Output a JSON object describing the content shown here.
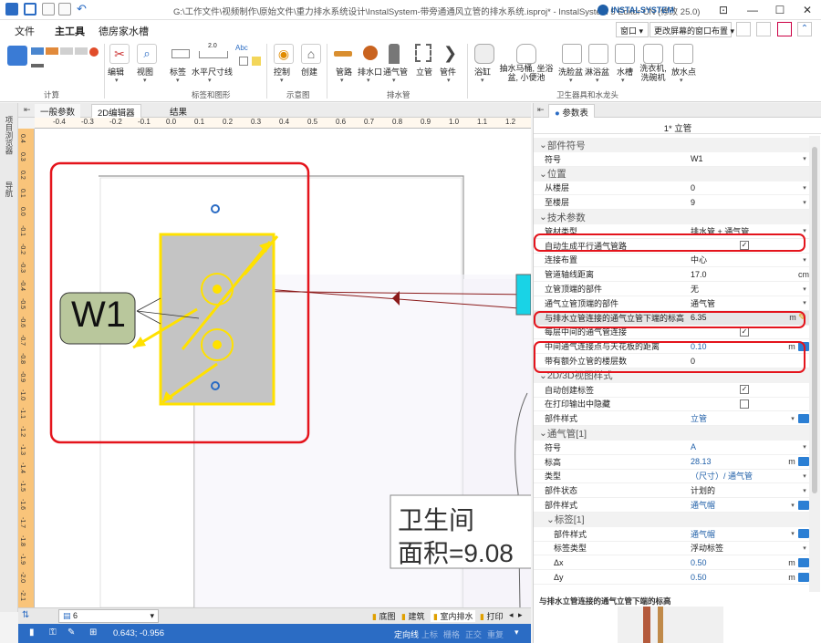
{
  "window": {
    "title": "G:\\工作文件\\视频制作\\原始文件\\重力排水系统设计\\InstalSystem-带旁通通风立管的排水系统.isproj* - InstalSystem 5 Editor CN (修改 25.0)",
    "logo_text": "INSTALSYSTEM"
  },
  "menu": {
    "items": [
      "文件",
      "主工具",
      "德房家水槽"
    ],
    "window_dropdown": "窗口",
    "layout_dropdown": "更改屏幕的窗口布置"
  },
  "ribbon": {
    "groups": [
      {
        "label": "计算"
      },
      {
        "label": "标签和图形",
        "buttons": [
          "编辑",
          "视图",
          "标签",
          "水平尺寸线"
        ]
      },
      {
        "label": "示意图",
        "buttons": [
          "控制",
          "创建"
        ]
      },
      {
        "label": "排水管",
        "buttons": [
          "管路",
          "排水口",
          "通气管",
          "立管",
          "管件"
        ]
      },
      {
        "label": "卫生器具和水龙头",
        "buttons": [
          "浴缸",
          "抽水马桶, 坐浴盆, 小便池",
          "洗脸盆",
          "淋浴盆",
          "水槽",
          "洗衣机, 洗碗机",
          "放水点"
        ]
      }
    ],
    "abc_label": "Abc",
    "dim_label": "2.0"
  },
  "side_tabs": [
    "项目浏览器",
    "导航"
  ],
  "doc_tabs": [
    "一般参数",
    "2D编辑器",
    "结果"
  ],
  "ruler": {
    "h_ticks": [
      "-0.4",
      "-0.3",
      "-0.2",
      "-0.1",
      "0.0",
      "0.1",
      "0.2",
      "0.3",
      "0.4",
      "0.5",
      "0.6",
      "0.7",
      "0.8",
      "0.9",
      "1.0",
      "1.1",
      "1.2",
      "1.3"
    ],
    "v_ticks": [
      "0.4",
      "0.3",
      "0.2",
      "0.1",
      "0.0",
      "-0.1",
      "-0.2",
      "-0.3",
      "-0.4",
      "-0.5",
      "-0.6",
      "-0.7",
      "-0.8",
      "-0.9",
      "-1.0",
      "-1.1",
      "-1.2",
      "-1.3",
      "-1.4",
      "-1.5",
      "-1.6",
      "-1.7",
      "-1.8",
      "-1.9",
      "-2.0",
      "-2.1"
    ]
  },
  "canvas": {
    "riser_label": "W1",
    "room_name": "卫生间",
    "room_area": "面积=9.08"
  },
  "bottom_tabs": [
    "底图",
    "建筑",
    "室内排水",
    "打印"
  ],
  "status": {
    "zoom_value": "6",
    "coords": "0.643; -0.956",
    "mode_items": [
      "定向线",
      "上标",
      "栅格",
      "正交",
      "重复"
    ]
  },
  "props": {
    "panel_title": "参数表",
    "object_title": "1* 立管",
    "rows": [
      {
        "type": "cat",
        "label": "部件符号"
      },
      {
        "type": "row",
        "label": "符号",
        "value": "W1",
        "dd": true
      },
      {
        "type": "cat",
        "label": "位置"
      },
      {
        "type": "row",
        "label": "从楼层",
        "value": "0",
        "dd": true
      },
      {
        "type": "row",
        "label": "至楼层",
        "value": "9",
        "dd": true
      },
      {
        "type": "cat",
        "label": "技术参数"
      },
      {
        "type": "row",
        "label": "管材类型",
        "value": "排水管 + 通气管",
        "dd": true
      },
      {
        "type": "row",
        "label": "自动生成平行通气管路",
        "check": true
      },
      {
        "type": "row",
        "label": "连接布置",
        "value": "中心",
        "dd": true
      },
      {
        "type": "row",
        "label": "管道轴线距离",
        "value": "17.0",
        "unit": "cm"
      },
      {
        "type": "row",
        "label": "立管顶端的部件",
        "value": "无",
        "dd": true
      },
      {
        "type": "row",
        "label": "通气立管顶端的部件",
        "value": "通气管",
        "dd": true
      },
      {
        "type": "row",
        "label": "与排水立管连接的通气立管下端的标高",
        "value": "6.35",
        "unit": "m",
        "icon": "pencil-icon",
        "shade": true
      },
      {
        "type": "row",
        "label": "每层中间的通气管连接",
        "check": true
      },
      {
        "type": "row",
        "label": "中间通气连接点与天花板的距离",
        "value": "0.10",
        "unit": "m",
        "icon": "link-icon",
        "blue": true
      },
      {
        "type": "row",
        "label": "带有额外立管的楼层数",
        "value": "0"
      },
      {
        "type": "cat",
        "label": "2D/3D视图样式"
      },
      {
        "type": "row",
        "label": "自动创建标签",
        "check": true
      },
      {
        "type": "row",
        "label": "在打印输出中隐藏",
        "check": false
      },
      {
        "type": "row",
        "label": "部件样式",
        "value": "立管",
        "dd": true,
        "icon": "link-icon",
        "blue": true
      },
      {
        "type": "cat",
        "label": "通气管[1]"
      },
      {
        "type": "row",
        "label": "符号",
        "value": "A",
        "dd": true,
        "blue": true
      },
      {
        "type": "row",
        "label": "标高",
        "value": "28.13",
        "unit": "m",
        "icon": "link-icon",
        "blue": true
      },
      {
        "type": "row",
        "label": "类型",
        "value": "（尺寸）/ 通气管",
        "dd": true,
        "blue": true
      },
      {
        "type": "row",
        "label": "部件状态",
        "value": "计划的",
        "dd": true
      },
      {
        "type": "row",
        "label": "部件样式",
        "value": "通气帽",
        "dd": true,
        "icon": "link-icon",
        "blue": true
      },
      {
        "type": "cat",
        "label": "标签[1]",
        "sub": true
      },
      {
        "type": "row",
        "label": "部件样式",
        "value": "通气帽",
        "dd": true,
        "icon": "link-icon",
        "blue": true,
        "sub": true
      },
      {
        "type": "row",
        "label": "标签类型",
        "value": "浮动标签",
        "dd": true,
        "sub": true
      },
      {
        "type": "row",
        "label": "Δx",
        "value": "0.50",
        "unit": "m",
        "icon": "link-icon",
        "blue": true,
        "sub": true
      },
      {
        "type": "row",
        "label": "Δy",
        "value": "0.50",
        "unit": "m",
        "icon": "link-icon",
        "blue": true,
        "sub": true
      }
    ],
    "help_title": "与排水立管连接的通气立管下端的标高"
  },
  "colors": {
    "accent": "#2b6cc4",
    "highlight_red": "#e4141c",
    "riser_yellow": "#ffe100",
    "riser_fill": "#c4c4c4",
    "label_green": "#b9c79c",
    "pipe_red": "#8b1a1a",
    "ruler_orange": "#f9c47a"
  }
}
